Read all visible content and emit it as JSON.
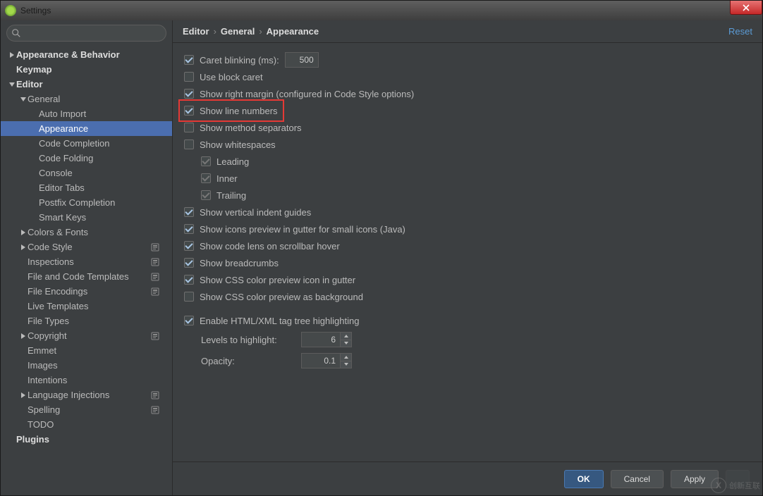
{
  "title": "Settings",
  "breadcrumb": [
    "Editor",
    "General",
    "Appearance"
  ],
  "reset_label": "Reset",
  "sidebar": {
    "search_placeholder": "",
    "items": [
      {
        "label": "Appearance & Behavior",
        "indent": 0,
        "arrow": "right",
        "bold": true
      },
      {
        "label": "Keymap",
        "indent": 0,
        "arrow": "none",
        "bold": true
      },
      {
        "label": "Editor",
        "indent": 0,
        "arrow": "down",
        "bold": true
      },
      {
        "label": "General",
        "indent": 1,
        "arrow": "down",
        "bold": false
      },
      {
        "label": "Auto Import",
        "indent": 2,
        "arrow": "none",
        "bold": false
      },
      {
        "label": "Appearance",
        "indent": 2,
        "arrow": "none",
        "bold": false,
        "selected": true
      },
      {
        "label": "Code Completion",
        "indent": 2,
        "arrow": "none",
        "bold": false
      },
      {
        "label": "Code Folding",
        "indent": 2,
        "arrow": "none",
        "bold": false
      },
      {
        "label": "Console",
        "indent": 2,
        "arrow": "none",
        "bold": false
      },
      {
        "label": "Editor Tabs",
        "indent": 2,
        "arrow": "none",
        "bold": false
      },
      {
        "label": "Postfix Completion",
        "indent": 2,
        "arrow": "none",
        "bold": false
      },
      {
        "label": "Smart Keys",
        "indent": 2,
        "arrow": "none",
        "bold": false
      },
      {
        "label": "Colors & Fonts",
        "indent": 1,
        "arrow": "right",
        "bold": false
      },
      {
        "label": "Code Style",
        "indent": 1,
        "arrow": "right",
        "bold": false,
        "proj": true
      },
      {
        "label": "Inspections",
        "indent": 1,
        "arrow": "none",
        "bold": false,
        "proj": true
      },
      {
        "label": "File and Code Templates",
        "indent": 1,
        "arrow": "none",
        "bold": false,
        "proj": true
      },
      {
        "label": "File Encodings",
        "indent": 1,
        "arrow": "none",
        "bold": false,
        "proj": true
      },
      {
        "label": "Live Templates",
        "indent": 1,
        "arrow": "none",
        "bold": false
      },
      {
        "label": "File Types",
        "indent": 1,
        "arrow": "none",
        "bold": false
      },
      {
        "label": "Copyright",
        "indent": 1,
        "arrow": "right",
        "bold": false,
        "proj": true
      },
      {
        "label": "Emmet",
        "indent": 1,
        "arrow": "none",
        "bold": false
      },
      {
        "label": "Images",
        "indent": 1,
        "arrow": "none",
        "bold": false
      },
      {
        "label": "Intentions",
        "indent": 1,
        "arrow": "none",
        "bold": false
      },
      {
        "label": "Language Injections",
        "indent": 1,
        "arrow": "right",
        "bold": false,
        "proj": true
      },
      {
        "label": "Spelling",
        "indent": 1,
        "arrow": "none",
        "bold": false,
        "proj": true
      },
      {
        "label": "TODO",
        "indent": 1,
        "arrow": "none",
        "bold": false
      },
      {
        "label": "Plugins",
        "indent": 0,
        "arrow": "none",
        "bold": true
      }
    ]
  },
  "options": {
    "caret_blinking_label": "Caret blinking (ms):",
    "caret_blinking_value": "500",
    "use_block_caret": "Use block caret",
    "show_right_margin": "Show right margin (configured in Code Style options)",
    "show_line_numbers": "Show line numbers",
    "show_method_separators": "Show method separators",
    "show_whitespaces": "Show whitespaces",
    "leading": "Leading",
    "inner": "Inner",
    "trailing": "Trailing",
    "show_vertical_indent": "Show vertical indent guides",
    "show_icons_preview": "Show icons preview in gutter for small icons (Java)",
    "show_code_lens": "Show code lens on scrollbar hover",
    "show_breadcrumbs": "Show breadcrumbs",
    "show_css_gutter": "Show CSS color preview icon in gutter",
    "show_css_bg": "Show CSS color preview as background",
    "enable_html_xml": "Enable HTML/XML tag tree highlighting",
    "levels_label": "Levels to highlight:",
    "levels_value": "6",
    "opacity_label": "Opacity:",
    "opacity_value": "0.1"
  },
  "buttons": {
    "ok": "OK",
    "cancel": "Cancel",
    "apply": "Apply"
  },
  "watermark": "创新互联"
}
